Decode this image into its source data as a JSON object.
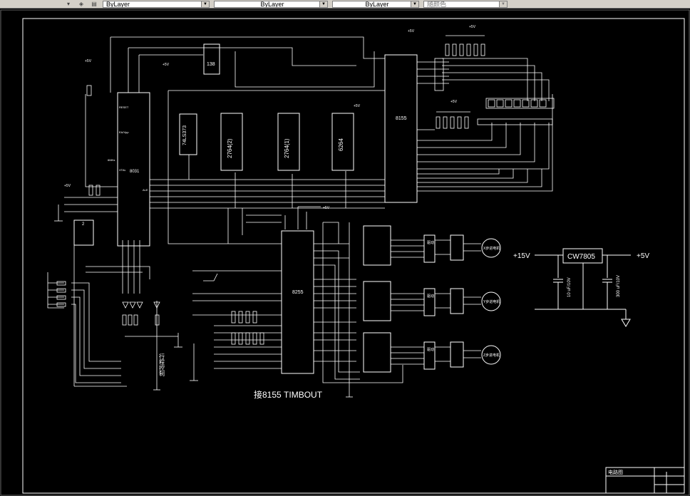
{
  "toolbar": {
    "layer_combo": "ByLayer",
    "linetype_combo": "ByLayer",
    "lineweight_combo": "ByLayer",
    "plotstyle_combo": "随颜色"
  },
  "drawing": {
    "chips": {
      "u138": "138",
      "u8031": "8031",
      "u74ls373": "74LS373",
      "u2764a": "2764(2)",
      "u2764b": "2764(1)",
      "u6264": "6264",
      "u8155": "8155",
      "u8255": "8255",
      "u_lower_left": "2",
      "drv1": "驱动",
      "drv2": "驱动",
      "drv3": "驱动"
    },
    "labels": {
      "plus5v_a": "+5V",
      "plus5v_b": "+5V",
      "plus5v_c": "+5V",
      "plus5v_d": "+5V",
      "plus5v_e": "+5V",
      "plus5v_f": "+5V",
      "plus5v_g": "+5V",
      "plus5v_h": "+5V",
      "reset": "RESET",
      "xtal": "XTAL",
      "ea": "EA/Vpp",
      "ale": "ALE",
      "six_mhz": "6MHz",
      "limit_ctrl": "行程控制",
      "timbout": "接8155 TIMBOUT",
      "motor_x": "X步进电机",
      "motor_y": "Y步进电机",
      "motor_z": "Z步进电机"
    },
    "regulator": {
      "in_label": "+15V",
      "chip": "CW7805",
      "out_label": "+5V",
      "cap1": "10 uF/10V",
      "cap2": "300 uF/10V"
    },
    "title_block": {
      "name": "电路图"
    }
  }
}
